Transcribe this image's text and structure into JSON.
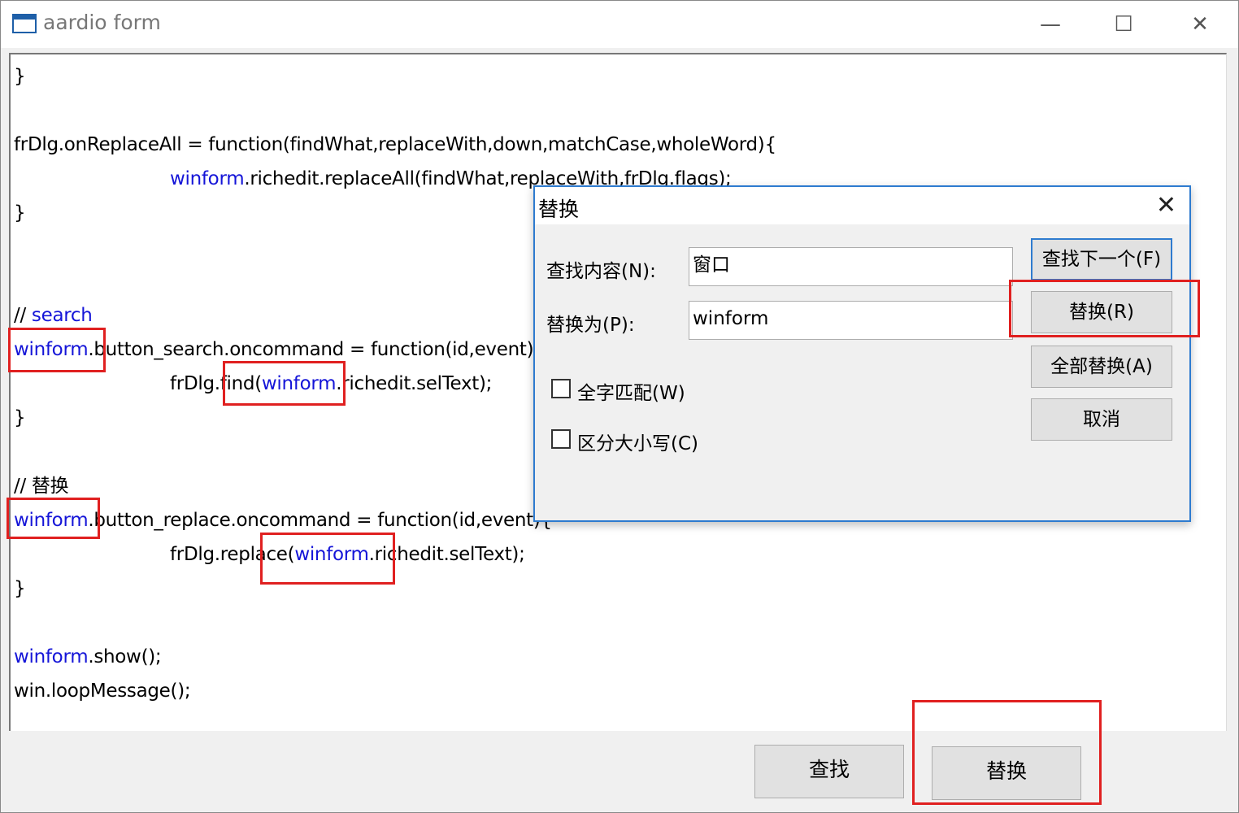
{
  "window": {
    "title": "aardio form",
    "controls": {
      "minimize": "—",
      "maximize": "☐",
      "close": "✕"
    }
  },
  "editor": {
    "lines": {
      "l1": [
        "}"
      ],
      "l2": [
        "frDlg.onReplaceAll = function(findWhat,replaceWith,down,matchCase,wholeWord){"
      ],
      "l3": [
        "winform",
        ".richedit.replaceAll(findWhat,replaceWith,frDlg.flags);"
      ],
      "l4": [
        "}"
      ],
      "l5": [
        "// ",
        "search"
      ],
      "l6": [
        "winform",
        ".button_search.oncommand = function(id,event){"
      ],
      "l7": [
        "frDlg.find(",
        "winform",
        ".richedit.selText);"
      ],
      "l8": [
        "}"
      ],
      "l9": [
        "// 替换"
      ],
      "l10": [
        "winform",
        ".button_replace.oncommand = function(id,event){"
      ],
      "l11": [
        "frDlg.replace(",
        "winform",
        ".richedit.selText);"
      ],
      "l12": [
        "}"
      ],
      "l13": [
        "winform",
        ".show();"
      ],
      "l14": [
        "win.loopMessage();"
      ]
    }
  },
  "form_buttons": {
    "find": "查找",
    "replace": "替换"
  },
  "dialog": {
    "title": "替换",
    "close": "✕",
    "find_label": "查找内容(N):",
    "find_value": "窗口",
    "replace_label": "替换为(P):",
    "replace_value": "winform",
    "whole_word_label": "全字匹配(W)",
    "whole_word_checked": false,
    "match_case_label": "区分大小写(C)",
    "match_case_checked": false,
    "buttons": {
      "find_next": "查找下一个(F)",
      "replace": "替换(R)",
      "replace_all": "全部替换(A)",
      "cancel": "取消"
    }
  },
  "colors": {
    "keyword": "#1515d8",
    "highlight": "#e02020",
    "dialog_border": "#2e7bcf"
  }
}
